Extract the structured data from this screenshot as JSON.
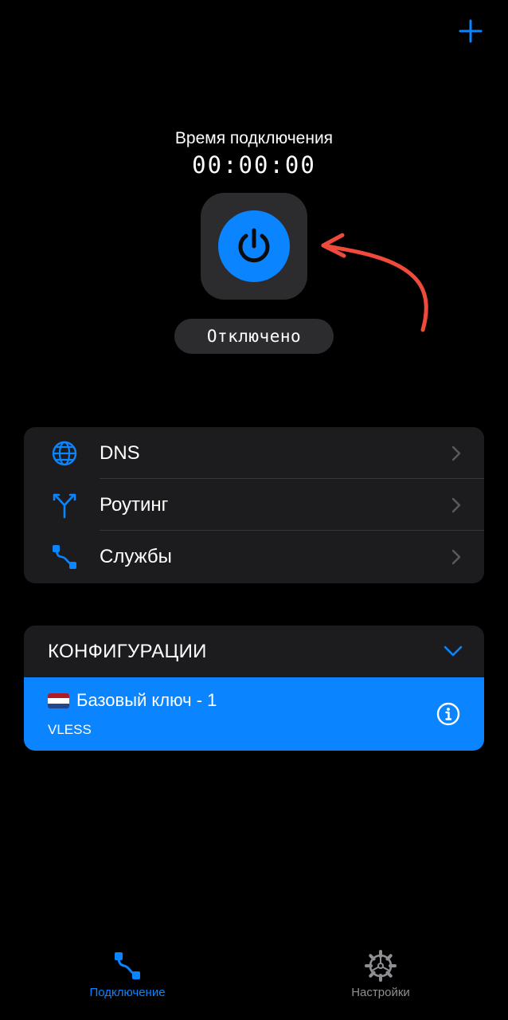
{
  "header": {
    "add_icon": "plus-icon"
  },
  "connection": {
    "title": "Время подключения",
    "timer": "00:00:00",
    "status": "Отключено",
    "power_icon": "power-icon",
    "accent": "#0a84ff"
  },
  "menu": {
    "items": [
      {
        "label": "DNS",
        "icon": "globe-icon"
      },
      {
        "label": "Роутинг",
        "icon": "routing-fork-icon"
      },
      {
        "label": "Службы",
        "icon": "services-path-icon"
      }
    ]
  },
  "configs": {
    "title": "КОНФИГУРАЦИИ",
    "items": [
      {
        "name": "Базовый ключ - 1",
        "protocol": "VLESS",
        "flag": "netherlands-flag-icon",
        "selected": true
      }
    ]
  },
  "tabbar": {
    "tabs": [
      {
        "label": "Подключение",
        "icon": "connection-path-icon",
        "active": true
      },
      {
        "label": "Настройки",
        "icon": "gear-icon",
        "active": false
      }
    ]
  },
  "colors": {
    "accent": "#0a84ff",
    "card": "#1c1c1e",
    "tile": "#2c2c2e",
    "annotation": "#ef4a3c"
  }
}
